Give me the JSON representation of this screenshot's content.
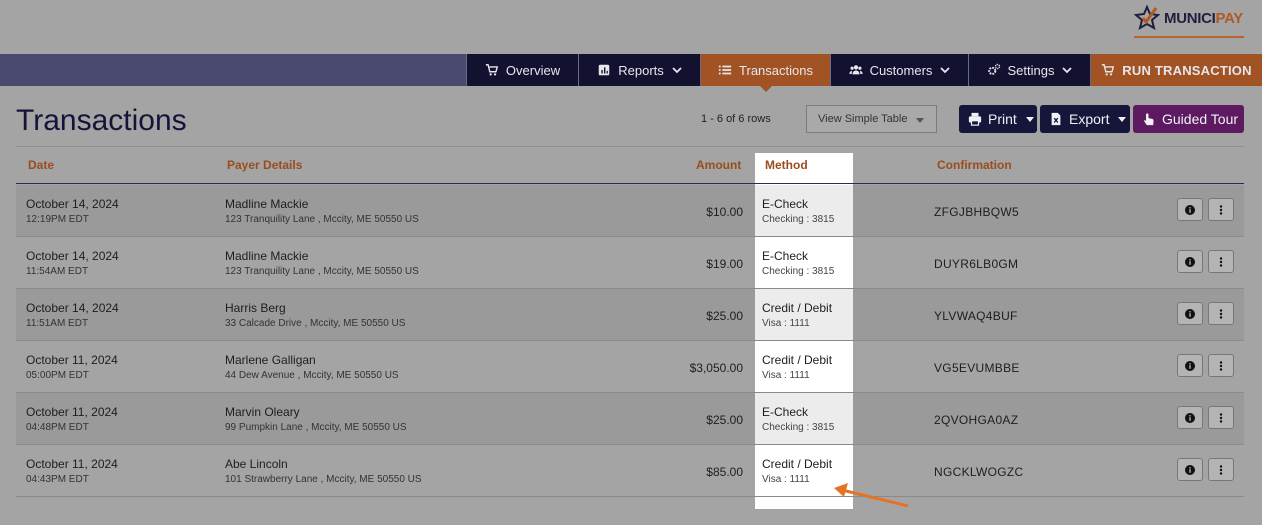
{
  "brand": {
    "name_part1": "MUNICI",
    "name_part2": "PAY"
  },
  "nav": {
    "overview": "Overview",
    "reports": "Reports",
    "transactions": "Transactions",
    "customers": "Customers",
    "settings": "Settings",
    "run": "RUN TRANSACTION"
  },
  "page": {
    "title": "Transactions",
    "row_count": "1 - 6 of 6 rows",
    "simple_table": "View Simple Table",
    "print": "Print",
    "export": "Export",
    "tour": "Guided Tour"
  },
  "table": {
    "headers": {
      "date": "Date",
      "payer": "Payer Details",
      "amount": "Amount",
      "method": "Method",
      "confirmation": "Confirmation"
    },
    "rows": [
      {
        "date": "October 14, 2024",
        "time": "12:19PM EDT",
        "name": "Madline Mackie",
        "address": "123 Tranquility Lane , Mccity, ME 50550 US",
        "amount": "$10.00",
        "method": "E-Check",
        "method_detail": "Checking : 3815",
        "confirmation": "ZFGJBHBQW5"
      },
      {
        "date": "October 14, 2024",
        "time": "11:54AM EDT",
        "name": "Madline Mackie",
        "address": "123 Tranquility Lane , Mccity, ME 50550 US",
        "amount": "$19.00",
        "method": "E-Check",
        "method_detail": "Checking : 3815",
        "confirmation": "DUYR6LB0GM"
      },
      {
        "date": "October 14, 2024",
        "time": "11:51AM EDT",
        "name": "Harris Berg",
        "address": "33 Calcade Drive , Mccity, ME 50550 US",
        "amount": "$25.00",
        "method": "Credit / Debit",
        "method_detail": "Visa : 1111",
        "confirmation": "YLVWAQ4BUF"
      },
      {
        "date": "October 11, 2024",
        "time": "05:00PM EDT",
        "name": "Marlene Galligan",
        "address": "44 Dew Avenue , Mccity, ME 50550 US",
        "amount": "$3,050.00",
        "method": "Credit / Debit",
        "method_detail": "Visa : 1111",
        "confirmation": "VG5EVUMBBE"
      },
      {
        "date": "October 11, 2024",
        "time": "04:48PM EDT",
        "name": "Marvin Oleary",
        "address": "99 Pumpkin Lane , Mccity, ME 50550 US",
        "amount": "$25.00",
        "method": "E-Check",
        "method_detail": "Checking : 3815",
        "confirmation": "2QVOHGA0AZ"
      },
      {
        "date": "October 11, 2024",
        "time": "04:43PM EDT",
        "name": "Abe Lincoln",
        "address": "101 Strawberry Lane , Mccity, ME 50550 US",
        "amount": "$85.00",
        "method": "Credit / Debit",
        "method_detail": "Visa : 1111",
        "confirmation": "NGCKLWOGZC"
      }
    ]
  },
  "colors": {
    "accent": "#a15323",
    "navy": "#121230",
    "tour": "#5d1a60"
  },
  "icons": [
    "cart-icon",
    "reports-icon",
    "list-icon",
    "users-icon",
    "gears-icon",
    "hand-pointer-icon",
    "print-icon",
    "excel-icon",
    "info-icon",
    "ellipsis-icon"
  ]
}
